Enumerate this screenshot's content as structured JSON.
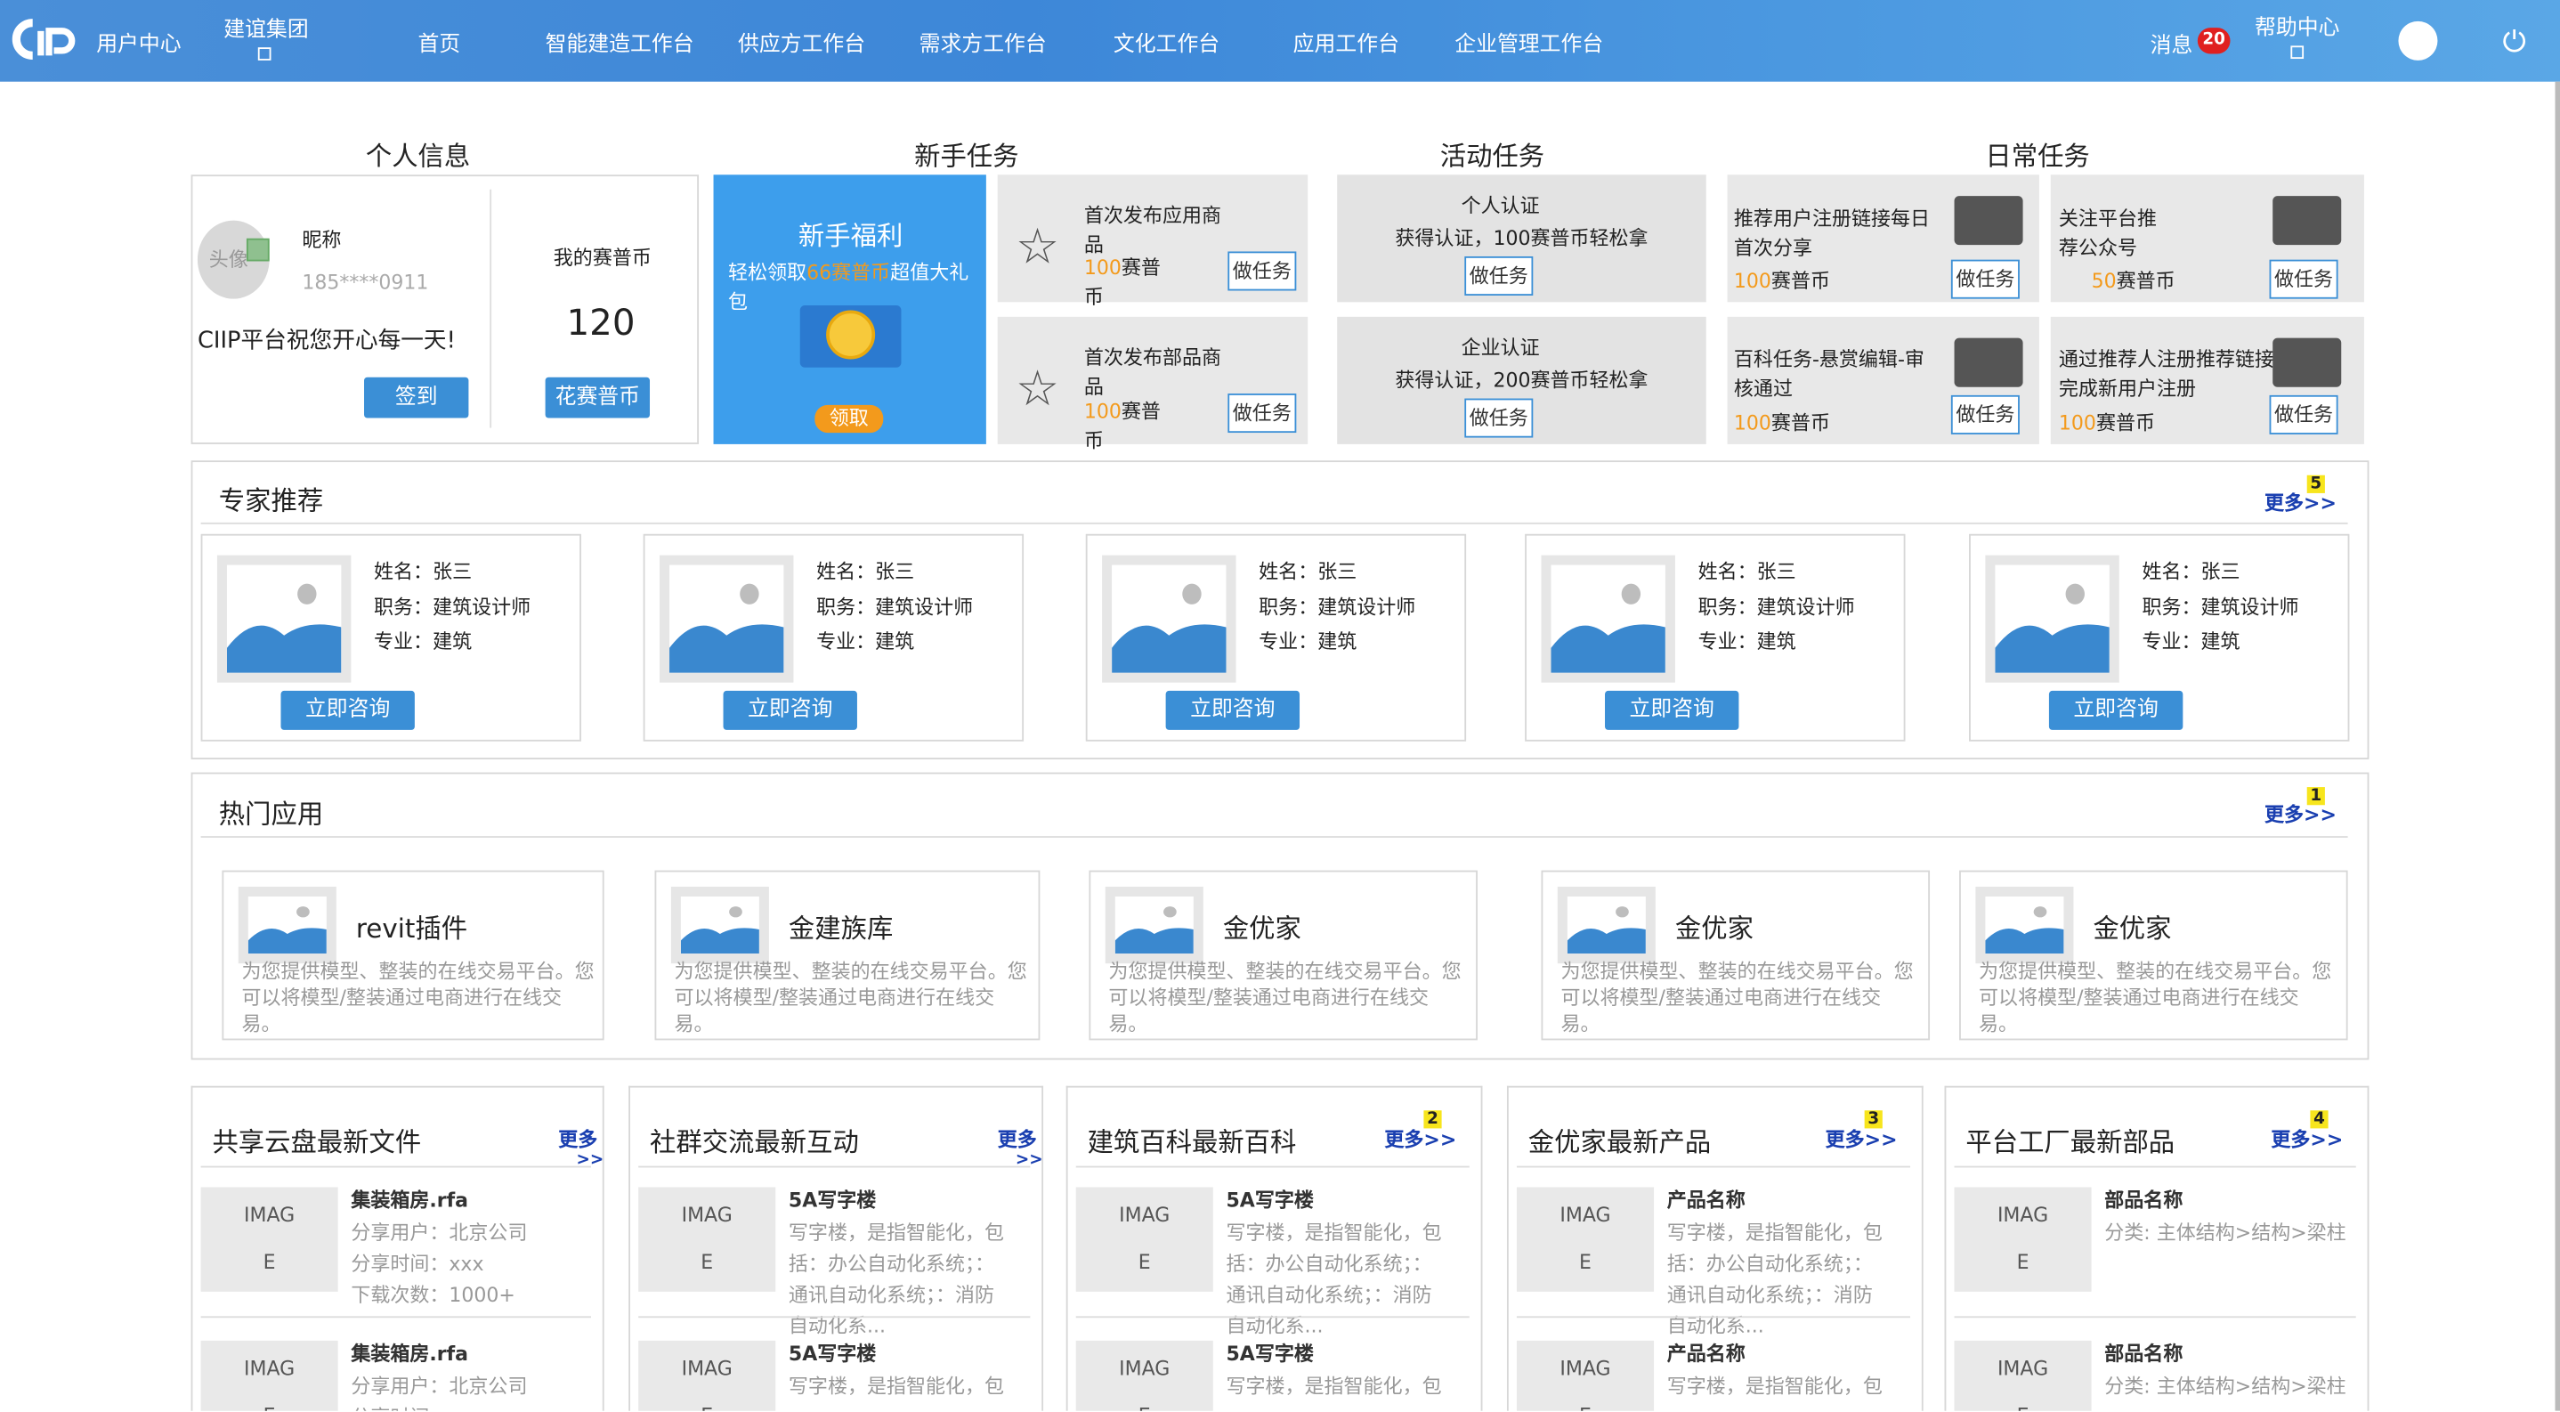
{
  "topbar": {
    "brand": "用户中心",
    "company": "建谊集团",
    "nav": [
      "首页",
      "智能建造工作台",
      "供应方工作台",
      "需求方工作台",
      "文化工作台",
      "应用工作台",
      "企业管理工作台"
    ],
    "messages_label": "消息",
    "messages_count": "20",
    "help": "帮助中心"
  },
  "sections": {
    "personal": "个人信息",
    "newbie": "新手任务",
    "activity": "活动任务",
    "daily": "日常任务"
  },
  "personal": {
    "avatar_text": "头像",
    "nickname_label": "昵称",
    "phone": "185****0911",
    "greeting": "CIIP平台祝您开心每一天!",
    "coins_label": "我的赛普币",
    "coins": "120",
    "checkin": "签到",
    "spend": "花赛普币"
  },
  "newbie_banner": {
    "title": "新手福利",
    "line_pre": "轻松领取",
    "line_hl": "66赛普币",
    "line_post": "超值大礼包",
    "claim": "领取"
  },
  "newbie_tasks": [
    {
      "title": "首次发布应用商品",
      "reward": "100",
      "unit": "赛普币",
      "btn": "做任务"
    },
    {
      "title": "首次发布部品商品",
      "reward": "100",
      "unit": "赛普币",
      "btn": "做任务"
    }
  ],
  "activity_tasks": [
    {
      "title": "个人认证",
      "desc": "获得认证，100赛普币轻松拿",
      "btn": "做任务"
    },
    {
      "title": "企业认证",
      "desc": "获得认证，200赛普币轻松拿",
      "btn": "做任务"
    }
  ],
  "daily_tasks": [
    {
      "title": "推荐用户注册链接每日首次分享",
      "reward": "100",
      "unit": "赛普币",
      "btn": "做任务"
    },
    {
      "title": "关注平台推荐公众号",
      "reward": "50",
      "unit": "赛普币",
      "btn": "做任务"
    },
    {
      "title": "百科任务-悬赏编辑-审核通过",
      "reward": "100",
      "unit": "赛普币",
      "btn": "做任务"
    },
    {
      "title": "通过推荐人注册推荐链接完成新用户注册",
      "reward": "100",
      "unit": "赛普币",
      "btn": "做任务"
    }
  ],
  "experts": {
    "title": "专家推荐",
    "more": "更多>>",
    "badge": "5",
    "consult": "立即咨询",
    "items": [
      {
        "name": "姓名：张三",
        "job": "职务：建筑设计师",
        "major": "专业：建筑"
      },
      {
        "name": "姓名：张三",
        "job": "职务：建筑设计师",
        "major": "专业：建筑"
      },
      {
        "name": "姓名：张三",
        "job": "职务：建筑设计师",
        "major": "专业：建筑"
      },
      {
        "name": "姓名：张三",
        "job": "职务：建筑设计师",
        "major": "专业：建筑"
      },
      {
        "name": "姓名：张三",
        "job": "职务：建筑设计师",
        "major": "专业：建筑"
      }
    ]
  },
  "apps": {
    "title": "热门应用",
    "more": "更多>>",
    "badge": "1",
    "items": [
      {
        "name": "revit插件",
        "desc": "为您提供模型、整装的在线交易平台。您可以将模型/整装通过电商进行在线交易。"
      },
      {
        "name": "金建族库",
        "desc": "为您提供模型、整装的在线交易平台。您可以将模型/整装通过电商进行在线交易。"
      },
      {
        "name": "金优家",
        "desc": "为您提供模型、整装的在线交易平台。您可以将模型/整装通过电商进行在线交易。"
      },
      {
        "name": "金优家",
        "desc": "为您提供模型、整装的在线交易平台。您可以将模型/整装通过电商进行在线交易。"
      },
      {
        "name": "金优家",
        "desc": "为您提供模型、整装的在线交易平台。您可以将模型/整装通过电商进行在线交易。"
      }
    ]
  },
  "panels": [
    {
      "title": "共享云盘最新文件",
      "more1": "更多",
      "more2": ">>",
      "badge": "",
      "items": [
        {
          "img1": "IMAG",
          "img2": "E",
          "title": "集装箱房.rfa",
          "l1": "分享用户：北京公司",
          "l2": "分享时间：xxx",
          "l3": "下载次数：1000+"
        },
        {
          "img1": "IMAG",
          "img2": "E",
          "title": "集装箱房.rfa",
          "l1": "分享用户：北京公司",
          "l2": "分享时间：",
          "l3": ""
        }
      ]
    },
    {
      "title": "社群交流最新互动",
      "more1": "更多",
      "more2": ">>",
      "badge": "",
      "items": [
        {
          "img1": "IMAG",
          "img2": "E",
          "title": "5A写字楼",
          "l1": "写字楼，是指智能化，包",
          "l2": "括：办公自动化系统；：",
          "l3": "通讯自动化系统；：消防",
          "l4": "自动化系..."
        },
        {
          "img1": "IMAG",
          "img2": "E",
          "title": "5A写字楼",
          "l1": "写字楼，是指智能化，包",
          "l2": "",
          "l3": ""
        }
      ]
    },
    {
      "title": "建筑百科最新百科",
      "more1": "更多>>",
      "more2": "",
      "badge": "2",
      "items": [
        {
          "img1": "IMAG",
          "img2": "E",
          "title": "5A写字楼",
          "l1": "写字楼，是指智能化，包",
          "l2": "括：办公自动化系统；：",
          "l3": "通讯自动化系统；：消防",
          "l4": "自动化系..."
        },
        {
          "img1": "IMAG",
          "img2": "E",
          "title": "5A写字楼",
          "l1": "写字楼，是指智能化，包",
          "l2": "",
          "l3": ""
        }
      ]
    },
    {
      "title": "金优家最新产品",
      "more1": "更多>>",
      "more2": "",
      "badge": "3",
      "items": [
        {
          "img1": "IMAG",
          "img2": "E",
          "title": "产品名称",
          "l1": "写字楼，是指智能化，包",
          "l2": "括：办公自动化系统；：",
          "l3": "通讯自动化系统；：消防",
          "l4": "自动化系..."
        },
        {
          "img1": "IMAG",
          "img2": "E",
          "title": "产品名称",
          "l1": "写字楼，是指智能化，包",
          "l2": "",
          "l3": ""
        }
      ]
    },
    {
      "title": "平台工厂最新部品",
      "more1": "更多>>",
      "more2": "",
      "badge": "4",
      "items": [
        {
          "img1": "IMAG",
          "img2": "E",
          "title": "部品名称",
          "l1": "分类: 主体结构>结构>梁柱",
          "l2": "",
          "l3": ""
        },
        {
          "img1": "IMAG",
          "img2": "E",
          "title": "部品名称",
          "l1": "分类: 主体结构>结构>梁柱",
          "l2": "",
          "l3": ""
        }
      ]
    }
  ]
}
